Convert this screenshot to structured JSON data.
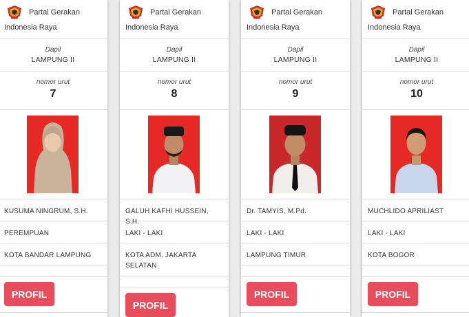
{
  "party": {
    "name_line1": "Partai Gerakan",
    "name_line2": "Indonesia Raya"
  },
  "labels": {
    "dapil": "Dapil",
    "nomor": "nomor urut",
    "button": "PROFIL"
  },
  "colors": {
    "button": "#e84d5d",
    "photo_background": "#e52a26",
    "party_logo": "#c0392b"
  },
  "candidates": [
    {
      "dapil": "LAMPUNG II",
      "nomor": "7",
      "name": "KUSUMA NINGRUM, S.H.",
      "gender": "PEREMPUAN",
      "region": "KOTA BANDAR LAMPUNG"
    },
    {
      "dapil": "LAMPUNG II",
      "nomor": "8",
      "name": "GALUH KAFHI HUSSEIN, S.H.",
      "gender": "LAKI - LAKI",
      "region": "KOTA ADM. JAKARTA SELATAN"
    },
    {
      "dapil": "LAMPUNG II",
      "nomor": "9",
      "name": "Dr. TAMYIS, M.Pd.",
      "gender": "LAKI - LAKI",
      "region": "LAMPUNG TIMUR"
    },
    {
      "dapil": "LAMPUNG II",
      "nomor": "10",
      "name": "MUCHLIDO APRILIAST",
      "gender": "LAKI - LAKI",
      "region": "KOTA BOGOR"
    }
  ]
}
